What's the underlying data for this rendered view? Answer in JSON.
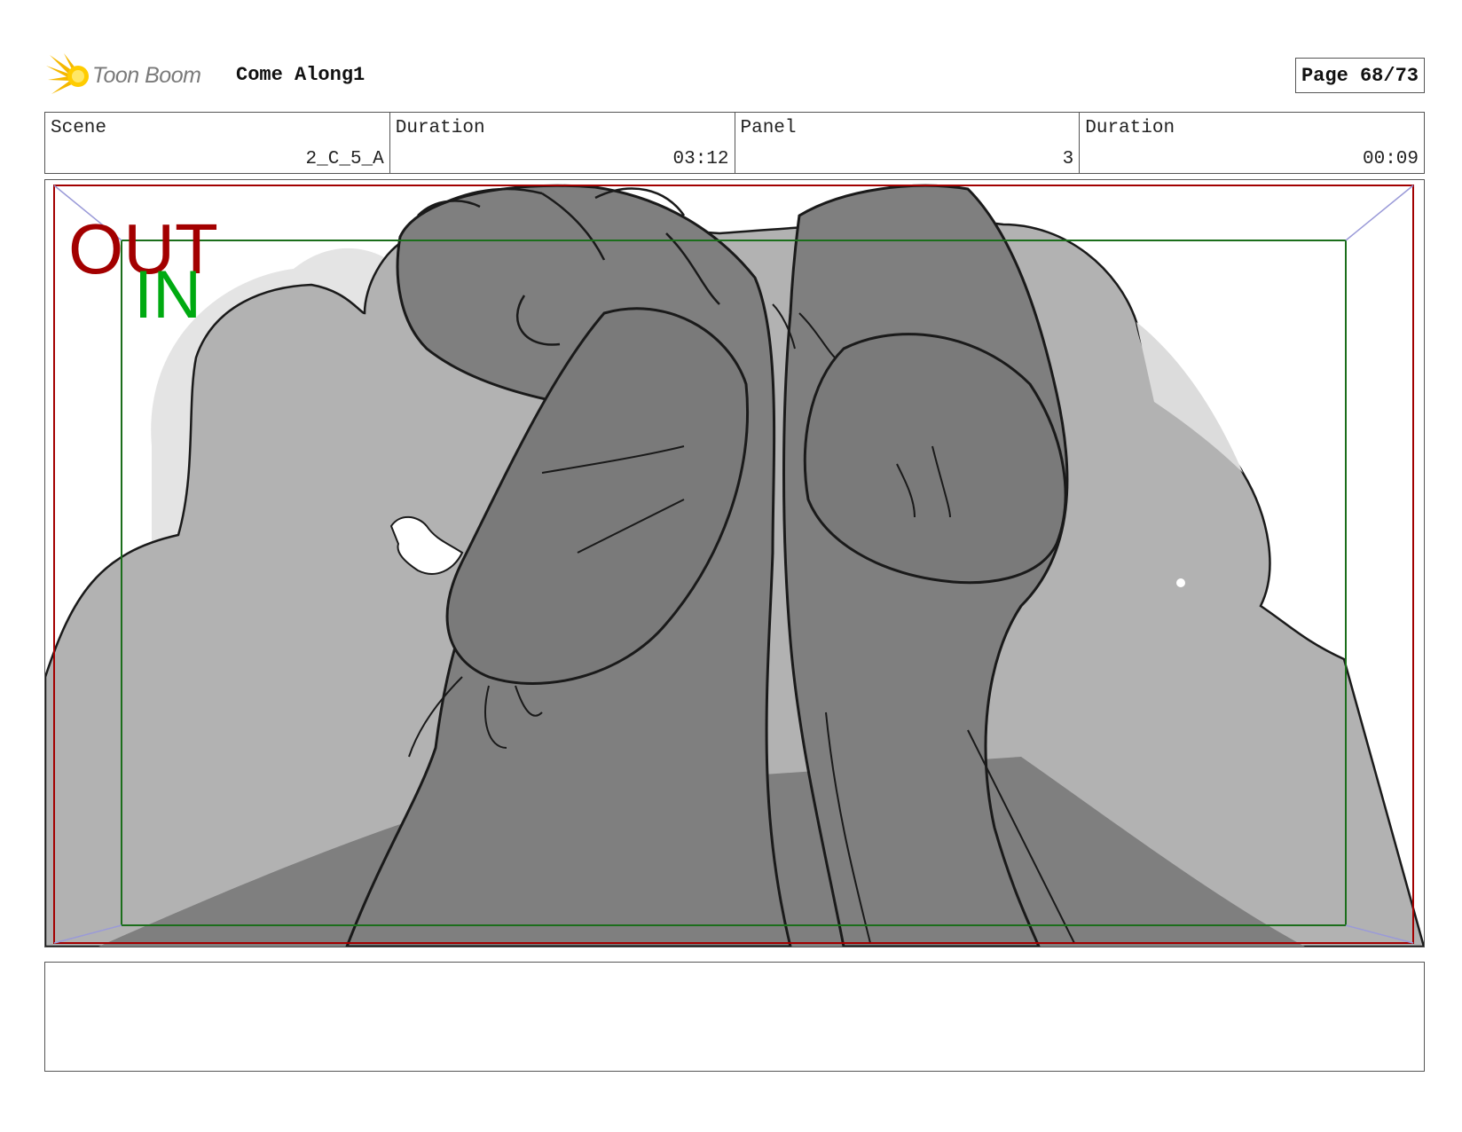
{
  "header": {
    "brand_name": "Toon Boom",
    "project_title": "Come Along1",
    "page_label": "Page 68/73"
  },
  "info": {
    "scene_label": "Scene",
    "scene_value": "2_C_5_A",
    "scene_duration_label": "Duration",
    "scene_duration_value": "03:12",
    "panel_label": "Panel",
    "panel_value": "3",
    "panel_duration_label": "Duration",
    "panel_duration_value": "00:09"
  },
  "panel": {
    "out_label": "OUT",
    "in_label": "IN",
    "colors": {
      "out_frame": "#a30000",
      "in_frame": "#1b6e1b",
      "perspective_lines": "#9a9ad8",
      "background_gray": "#b2b2b2",
      "figure_gray": "#7f7f7f",
      "hair_light": "#e6e6e6"
    }
  },
  "dialogue": {
    "text": ""
  },
  "icons": {
    "logo": "toon-boom-sun-icon"
  }
}
